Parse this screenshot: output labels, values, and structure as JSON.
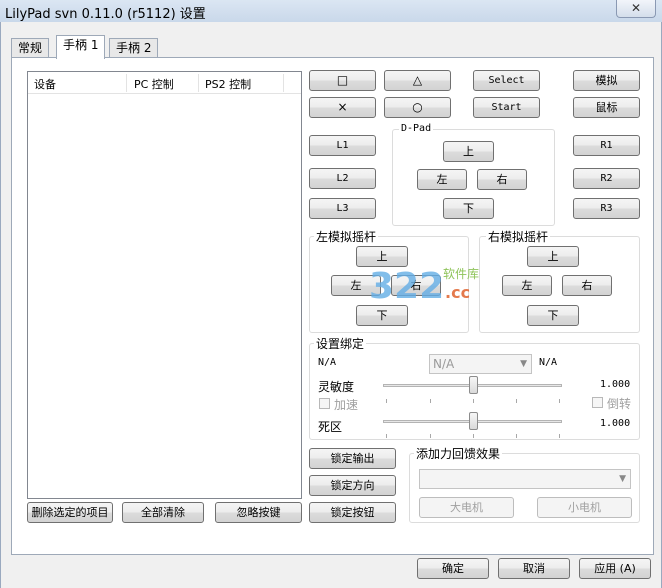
{
  "window": {
    "title": "LilyPad svn 0.11.0 (r5112) 设置",
    "close_glyph": "✕"
  },
  "tabs": [
    {
      "label": "常规"
    },
    {
      "label": "手柄 1"
    },
    {
      "label": "手柄 2"
    }
  ],
  "device_list": {
    "columns": [
      "设备",
      "PC 控制",
      "PS2 控制"
    ]
  },
  "face_buttons": {
    "square": "□",
    "triangle": "△",
    "cross": "×",
    "circle": "○",
    "select": "Select",
    "start": "Start",
    "analog": "模拟",
    "mouse": "鼠标",
    "l1": "L1",
    "l2": "L2",
    "l3": "L3",
    "r1": "R1",
    "r2": "R2",
    "r3": "R3"
  },
  "dpad": {
    "title": "D-Pad",
    "up": "上",
    "left": "左",
    "right": "右",
    "down": "下"
  },
  "left_stick": {
    "title": "左模拟摇杆",
    "up": "上",
    "left": "左",
    "right": "右",
    "down": "下"
  },
  "right_stick": {
    "title": "右模拟摇杆",
    "up": "上",
    "left": "左",
    "right": "右",
    "down": "下"
  },
  "binding": {
    "title": "设置绑定",
    "left_value": "N/A",
    "combo_value": "N/A",
    "right_value": "N/A",
    "sensitivity_label": "灵敏度",
    "sensitivity_value": "1.000",
    "sensitivity_level": 0.5,
    "accel_label": "加速",
    "invert_label": "倒转",
    "deadzone_label": "死区",
    "deadzone_value": "1.000",
    "deadzone_level": 0.5
  },
  "lock_buttons": {
    "output": "锁定输出",
    "direction": "锁定方向",
    "button": "锁定按钮"
  },
  "force_feedback": {
    "title": "添加力回馈效果",
    "big_motor": "大电机",
    "small_motor": "小电机"
  },
  "list_actions": {
    "delete_selected": "删除选定的项目",
    "clear_all": "全部清除",
    "ignore_key": "忽略按键"
  },
  "dialog": {
    "ok": "确定",
    "cancel": "取消",
    "apply": "应用 (A)"
  },
  "watermark": {
    "text": "软件库",
    "domain": ".cc",
    "digits": "322"
  }
}
